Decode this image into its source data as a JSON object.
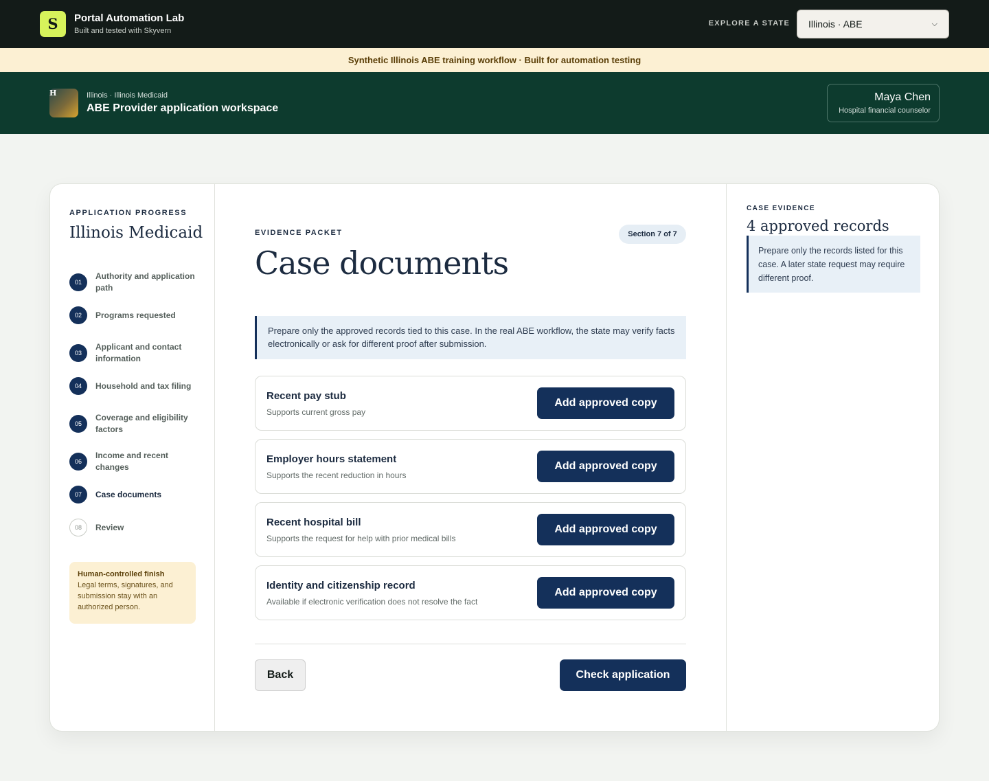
{
  "topbar": {
    "logo_letter": "S",
    "brand_title": "Portal Automation Lab",
    "brand_subtitle": "Built and tested with Skyvern",
    "explore_label": "EXPLORE A STATE",
    "state_select_value": "Illinois · ABE"
  },
  "banner": {
    "text": "Synthetic Illinois ABE training workflow · Built for automation testing"
  },
  "provider": {
    "avatar_letter": "H",
    "breadcrumb": "Illinois · Illinois Medicaid",
    "title": "ABE Provider application workspace",
    "user_name": "Maya Chen",
    "user_role": "Hospital financial counselor"
  },
  "sidebar": {
    "progress_label": "APPLICATION PROGRESS",
    "program_title": "Illinois Medicaid",
    "steps": [
      {
        "num": "01",
        "label": "Authority and application path",
        "status": "complete"
      },
      {
        "num": "02",
        "label": "Programs requested",
        "status": "complete"
      },
      {
        "num": "03",
        "label": "Applicant and contact information",
        "status": "complete"
      },
      {
        "num": "04",
        "label": "Household and tax filing",
        "status": "complete"
      },
      {
        "num": "05",
        "label": "Coverage and eligibility factors",
        "status": "complete"
      },
      {
        "num": "06",
        "label": "Income and recent changes",
        "status": "complete"
      },
      {
        "num": "07",
        "label": "Case documents",
        "status": "current"
      },
      {
        "num": "08",
        "label": "Review",
        "status": "pending"
      }
    ],
    "finish": {
      "title": "Human-controlled finish",
      "text": "Legal terms, signatures, and submission stay with an authorized person."
    }
  },
  "main": {
    "eyebrow": "EVIDENCE PACKET",
    "section_badge": "Section 7 of 7",
    "title": "Case documents",
    "notice": "Prepare only the approved records tied to this case. In the real ABE workflow, the state may verify facts electronically or ask for different proof after submission.",
    "documents": [
      {
        "title": "Recent pay stub",
        "subtitle": "Supports current gross pay",
        "button": "Add approved copy"
      },
      {
        "title": "Employer hours statement",
        "subtitle": "Supports the recent reduction in hours",
        "button": "Add approved copy"
      },
      {
        "title": "Recent hospital bill",
        "subtitle": "Supports the request for help with prior medical bills",
        "button": "Add approved copy"
      },
      {
        "title": "Identity and citizenship record",
        "subtitle": "Available if electronic verification does not resolve the fact",
        "button": "Add approved copy"
      }
    ],
    "back_label": "Back",
    "check_label": "Check application"
  },
  "evidence": {
    "label": "CASE EVIDENCE",
    "count_text": "4 approved records",
    "note": "Prepare only the records listed for this case. A later state request may require different proof."
  },
  "colors": {
    "topbar_bg": "#131b18",
    "logo_accent": "#d7f35b",
    "banner_bg": "#fcf0d3",
    "provider_bg": "#0d3b2e",
    "primary_navy": "#14305a",
    "notice_bg": "#e8f0f7"
  }
}
